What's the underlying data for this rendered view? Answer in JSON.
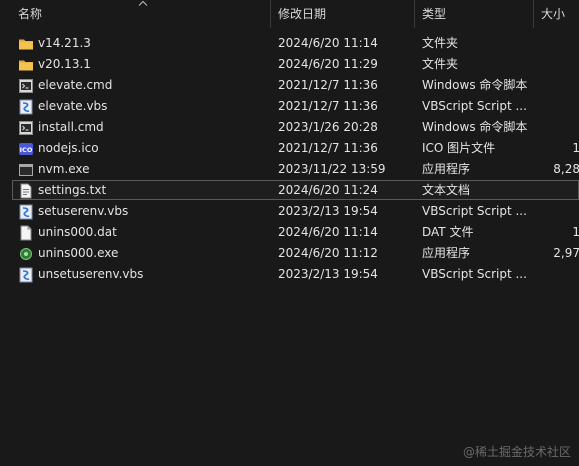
{
  "columns": {
    "name": "名称",
    "date": "修改日期",
    "type": "类型",
    "size": "大小"
  },
  "files": [
    {
      "name": "v14.21.3",
      "date": "2024/6/20 11:14",
      "type": "文件夹",
      "size": "",
      "icon": "folder-icon"
    },
    {
      "name": "v20.13.1",
      "date": "2024/6/20 11:29",
      "type": "文件夹",
      "size": "",
      "icon": "folder-icon"
    },
    {
      "name": "elevate.cmd",
      "date": "2021/12/7 11:36",
      "type": "Windows 命令脚本",
      "size": "",
      "icon": "cmd-script-icon"
    },
    {
      "name": "elevate.vbs",
      "date": "2021/12/7 11:36",
      "type": "VBScript Script ...",
      "size": "",
      "icon": "vbs-script-icon"
    },
    {
      "name": "install.cmd",
      "date": "2023/1/26 20:28",
      "type": "Windows 命令脚本",
      "size": "",
      "icon": "cmd-script-icon"
    },
    {
      "name": "nodejs.ico",
      "date": "2021/12/7 11:36",
      "type": "ICO 图片文件",
      "size": "1",
      "icon": "ico-image-icon"
    },
    {
      "name": "nvm.exe",
      "date": "2023/11/22 13:59",
      "type": "应用程序",
      "size": "8,28",
      "icon": "exe-app-icon"
    },
    {
      "name": "settings.txt",
      "date": "2024/6/20 11:24",
      "type": "文本文档",
      "size": "",
      "icon": "text-document-icon"
    },
    {
      "name": "setuserenv.vbs",
      "date": "2023/2/13 19:54",
      "type": "VBScript Script ...",
      "size": "",
      "icon": "vbs-script-icon"
    },
    {
      "name": "unins000.dat",
      "date": "2024/6/20 11:14",
      "type": "DAT 文件",
      "size": "1",
      "icon": "dat-file-icon"
    },
    {
      "name": "unins000.exe",
      "date": "2024/6/20 11:12",
      "type": "应用程序",
      "size": "2,97",
      "icon": "installer-exe-icon"
    },
    {
      "name": "unsetuserenv.vbs",
      "date": "2023/2/13 19:54",
      "type": "VBScript Script ...",
      "size": "",
      "icon": "vbs-script-icon"
    }
  ],
  "selected_index": 7,
  "watermark": "@稀土掘金技术社区",
  "colors": {
    "background": "#191919",
    "folder": "#f2c44f",
    "text": "#e4e4e4"
  }
}
